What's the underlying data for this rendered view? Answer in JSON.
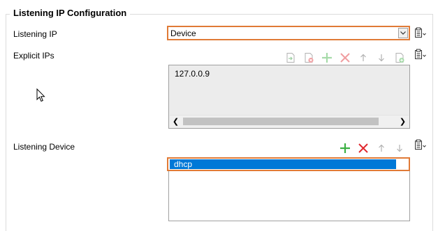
{
  "group": {
    "title": "Listening IP Configuration"
  },
  "listening_ip": {
    "label": "Listening IP",
    "selected": "Device"
  },
  "explicit_ips": {
    "label": "Explicit IPs",
    "items": [
      "127.0.0.9"
    ]
  },
  "listening_device": {
    "label": "Listening Device",
    "items": [
      "dhcp"
    ]
  },
  "icons": {
    "explicit_toolbar": [
      "import-icon",
      "delete-all-icon",
      "add-icon",
      "remove-icon",
      "move-up-icon",
      "move-down-icon",
      "add-from-list-icon"
    ],
    "device_toolbar": [
      "add-icon",
      "remove-icon",
      "move-up-icon",
      "move-down-icon"
    ],
    "menu": "clipboard-menu-icon"
  },
  "colors": {
    "highlight": "#e07a36",
    "selection": "#0078d7",
    "add": "#3cb043",
    "remove": "#e0282e"
  }
}
